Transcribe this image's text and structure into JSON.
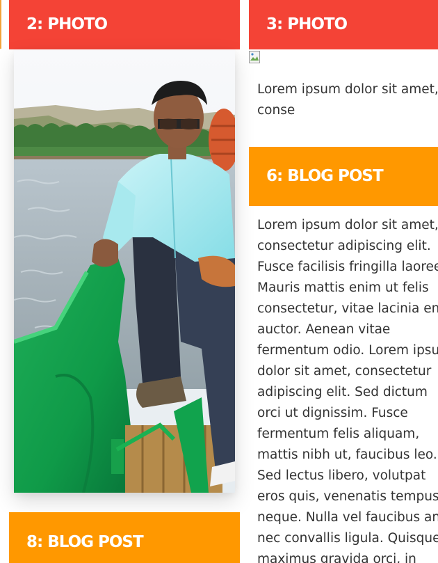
{
  "cards": {
    "photo2": {
      "title": "2: PHOTO"
    },
    "photo3": {
      "title": "3: PHOTO",
      "excerpt_lines": [
        "Lorem ipsum dolor sit amet,",
        "conse"
      ]
    },
    "blog6": {
      "title": "6: BLOG POST",
      "body_lines": [
        "Lorem ipsum dolor sit amet,",
        "consectetur adipiscing elit.",
        "Fusce facilisis fringilla laoreet.",
        "Mauris mattis enim ut felis",
        "consectetur, vitae lacinia enim",
        "auctor. Aenean vitae",
        "fermentum odio. Lorem ipsum",
        "dolor sit amet, consectetur",
        "adipiscing elit. Sed dictum",
        "orci ut dignissim. Fusce",
        "fermentum felis aliquam,",
        "mattis nibh ut, faucibus leo.",
        "Sed lectus libero, volutpat",
        "eros quis, venenatis tempus",
        "neque. Nulla vel faucibus ante,",
        "nec convallis ligula. Quisque",
        "maximus gravida orci, in"
      ]
    },
    "blog8": {
      "title": "8: BLOG POST"
    }
  },
  "colors": {
    "photo_header": "#f44336",
    "blog_header": "#ff9800"
  }
}
